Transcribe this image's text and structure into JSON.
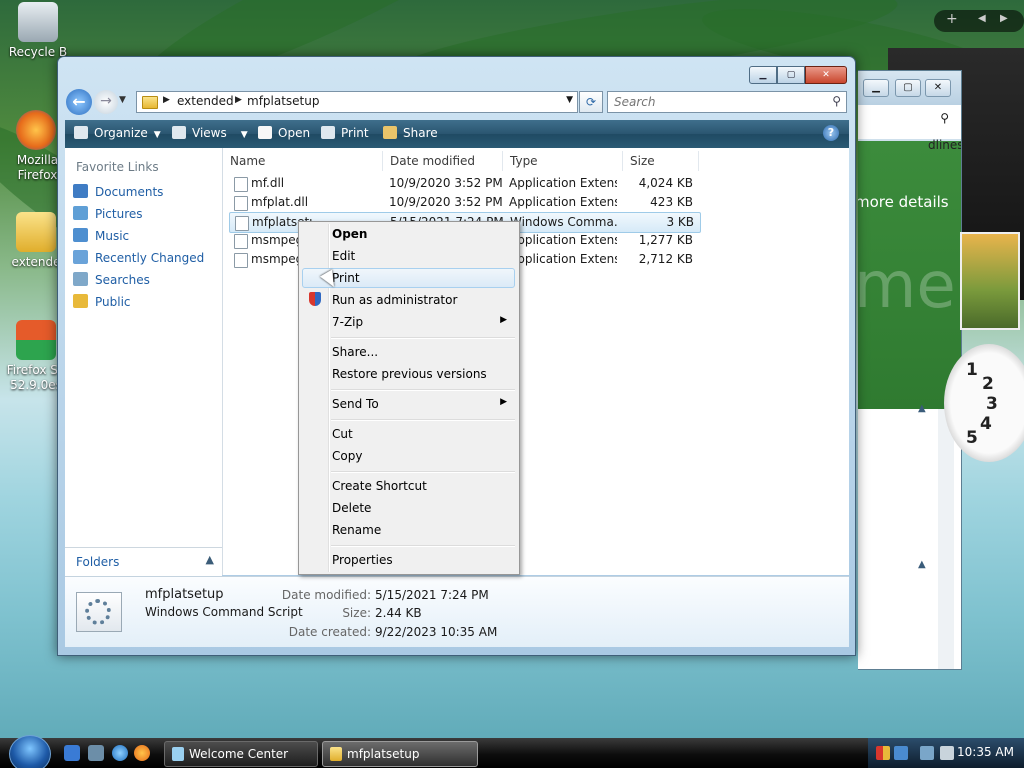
{
  "desktop": {
    "icons": [
      {
        "label": "Recycle B",
        "name": "recycle-bin-icon"
      },
      {
        "label": "Mozilla Firefox",
        "name": "firefox-icon"
      },
      {
        "label": "extende",
        "name": "folder-icon"
      },
      {
        "label": "Firefox Se 52.9.0es",
        "name": "firefox-setup-icon"
      }
    ],
    "back_window": {
      "text1": "dlines",
      "text2": "more details",
      "text3": "me"
    }
  },
  "window": {
    "breadcrumbs": [
      "extended",
      "mfplatsetup"
    ],
    "search_placeholder": "Search",
    "toolbar": {
      "organize": "Organize",
      "views": "Views",
      "open": "Open",
      "print": "Print",
      "share": "Share"
    }
  },
  "nav_pane": {
    "heading": "Favorite Links",
    "links": [
      {
        "label": "Documents",
        "color": "#3f7cc4"
      },
      {
        "label": "Pictures",
        "color": "#5f9fd6"
      },
      {
        "label": "Music",
        "color": "#4e8fd0"
      },
      {
        "label": "Recently Changed",
        "color": "#6aa3d9"
      },
      {
        "label": "Searches",
        "color": "#7fa8c9"
      },
      {
        "label": "Public",
        "color": "#e8b93a"
      }
    ],
    "folders_label": "Folders"
  },
  "columns": {
    "name": "Name",
    "date": "Date modified",
    "type": "Type",
    "size": "Size"
  },
  "files": [
    {
      "name": "mf.dll",
      "date": "10/9/2020 3:52 PM",
      "type": "Application Extens...",
      "size": "4,024 KB"
    },
    {
      "name": "mfplat.dll",
      "date": "10/9/2020 3:52 PM",
      "type": "Application Extens...",
      "size": "423 KB"
    },
    {
      "name": "mfplatsetup",
      "date": "5/15/2021 7:24 PM",
      "type": "Windows Comma...",
      "size": "3 KB"
    },
    {
      "name": "msmpeg2adec.dll",
      "date": "",
      "type": "Application Extens...",
      "size": "1,277 KB"
    },
    {
      "name": "msmpeg2vdec.dll",
      "date": "",
      "type": "Application Extens...",
      "size": "2,712 KB"
    }
  ],
  "details": {
    "name": "mfplatsetup",
    "type": "Windows Command Script",
    "modified_label": "Date modified:",
    "modified": "5/15/2021 7:24 PM",
    "size_label": "Size:",
    "size": "2.44 KB",
    "created_label": "Date created:",
    "created": "9/22/2023 10:35 AM"
  },
  "context_menu": [
    {
      "label": "Open"
    },
    {
      "label": "Edit"
    },
    {
      "label": "Print"
    },
    {
      "label": "Run as administrator"
    },
    {
      "label": "7-Zip"
    },
    {
      "label": "Share..."
    },
    {
      "label": "Restore previous versions"
    },
    {
      "label": "Send To"
    },
    {
      "label": "Cut"
    },
    {
      "label": "Copy"
    },
    {
      "label": "Create Shortcut"
    },
    {
      "label": "Delete"
    },
    {
      "label": "Rename"
    },
    {
      "label": "Properties"
    }
  ],
  "taskbar": {
    "tasks": [
      {
        "label": "Welcome Center"
      },
      {
        "label": "mfplatsetup"
      }
    ],
    "clock": "10:35 AM"
  },
  "gadgets": {
    "clock_numbers": [
      "1",
      "2",
      "3",
      "4",
      "5"
    ]
  }
}
